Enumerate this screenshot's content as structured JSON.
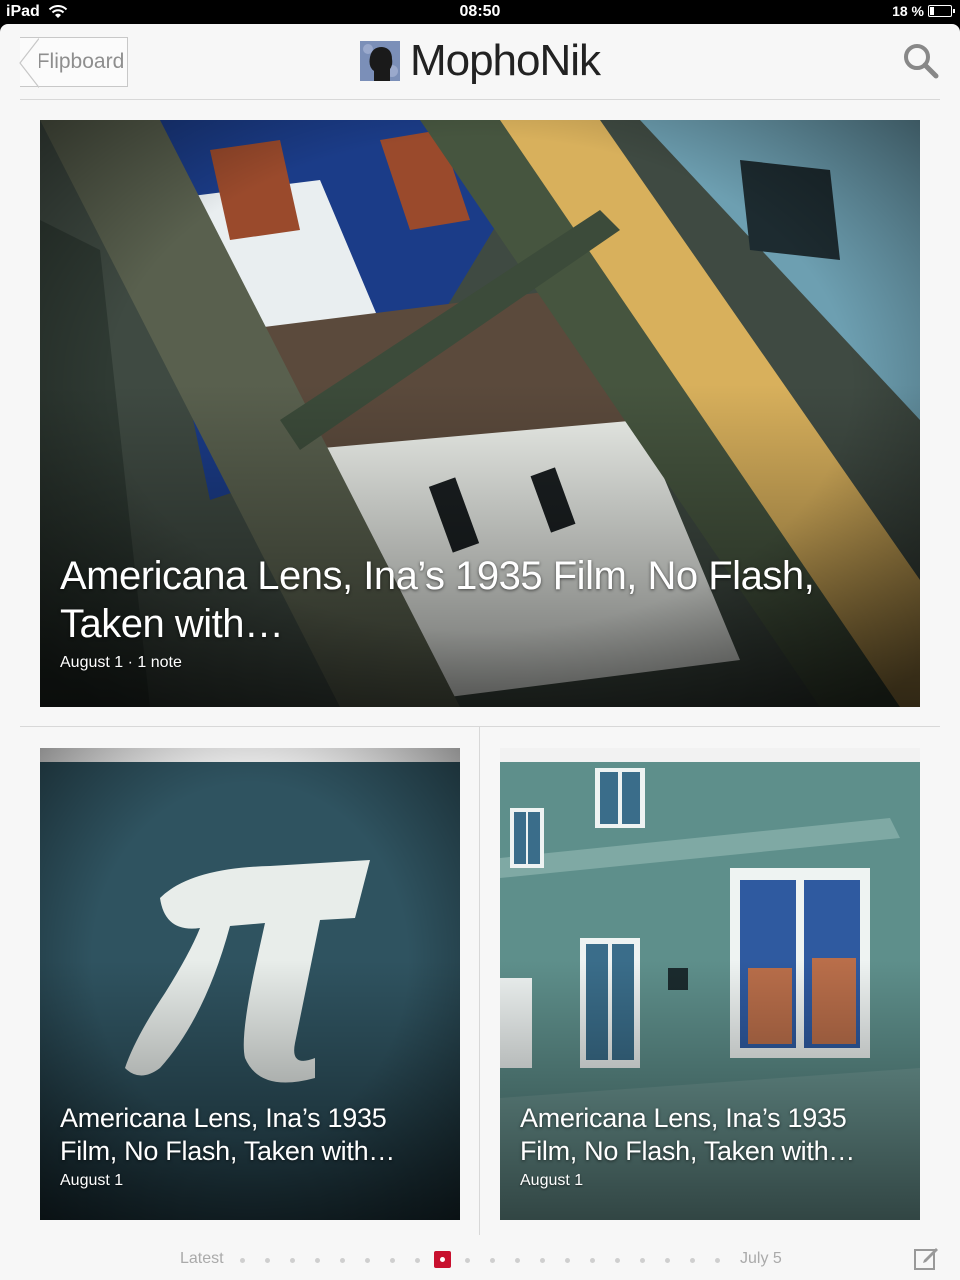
{
  "status_bar": {
    "device": "iPad",
    "time": "08:50",
    "battery": "18 %",
    "battery_level": 0.18
  },
  "header": {
    "back_label": "Flipboard",
    "title": "MophoNik"
  },
  "hero": {
    "headline": "Americana Lens, Ina’s 1935 Film, No Flash, Taken with…",
    "meta": "August 1 · 1 note"
  },
  "cards": [
    {
      "headline": "Americana Lens, Ina’s 1935 Film, No Flash, Taken with…",
      "meta": "August 1"
    },
    {
      "headline": "Americana Lens, Ina’s 1935 Film, No Flash, Taken with…",
      "meta": "August 1"
    }
  ],
  "pager": {
    "start_label": "Latest",
    "end_label": "July 5",
    "page_count": 20,
    "active_page": 8
  },
  "colors": {
    "accent": "#c8102e",
    "background": "#f7f7f7"
  },
  "icons": {
    "back": "chevron-back-icon",
    "search": "search-icon",
    "compose": "compose-icon",
    "wifi": "wifi-icon",
    "battery": "battery-icon"
  }
}
